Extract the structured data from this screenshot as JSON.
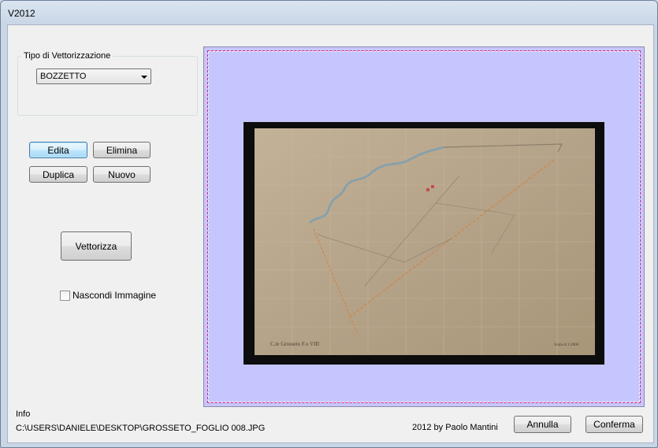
{
  "window": {
    "title": "V2012"
  },
  "vector_group": {
    "label": "Tipo di Vettorizzazione",
    "combo_value": "BOZZETTO"
  },
  "buttons": {
    "edita": "Edita",
    "elimina": "Elimina",
    "duplica": "Duplica",
    "nuovo": "Nuovo",
    "vettorizza": "Vettorizza",
    "annulla": "Annulla",
    "conferma": "Conferma"
  },
  "checkbox": {
    "label": "Nascondi Immagine",
    "checked": false
  },
  "map": {
    "footer_left": "C.te Grosseto F.o VIII",
    "footer_right": "Scala di 1:2000"
  },
  "footer": {
    "info_label": "Info",
    "path": "C:\\USERS\\DANIELE\\DESKTOP\\GROSSETO_FOGLIO 008.JPG",
    "credit": "2012 by Paolo Mantini"
  },
  "colors": {
    "canvas_bg": "#c6c6ff",
    "dash_color": "#e0206a",
    "paper": "#b5a389"
  }
}
